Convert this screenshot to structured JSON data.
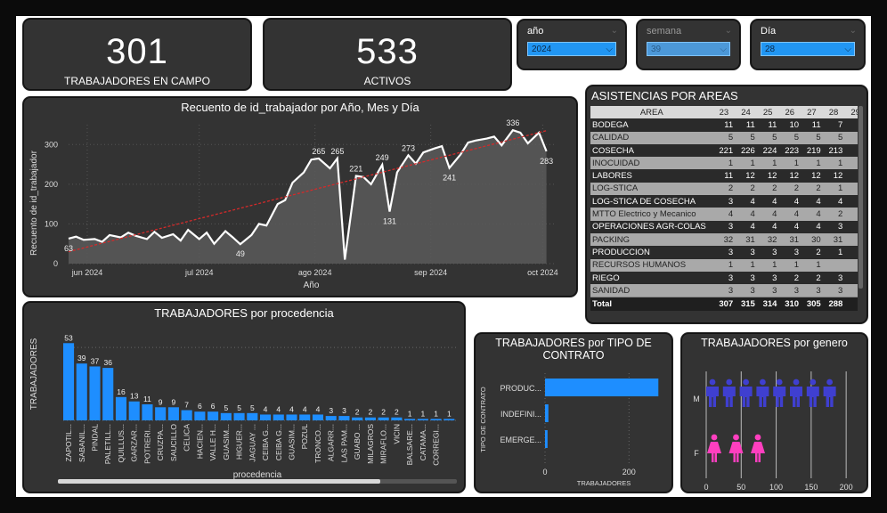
{
  "kpis": [
    {
      "value": "301",
      "label": "TRABAJADORES EN CAMPO"
    },
    {
      "value": "533",
      "label": "ACTIVOS"
    }
  ],
  "slicers": {
    "year": {
      "label": "año",
      "value": "2024"
    },
    "week": {
      "label": "semana",
      "value": "39"
    },
    "day": {
      "label": "Día",
      "value": "28"
    }
  },
  "line_chart": {
    "title": "Recuento de id_trabajador por Año, Mes y Día",
    "xlabel": "Año",
    "ylabel": "Recuento de id_trabajador",
    "y_ticks": [
      "0",
      "100",
      "200",
      "300"
    ],
    "x_ticks": [
      "jun 2024",
      "jul 2024",
      "ago 2024",
      "sep 2024",
      "oct 2024"
    ],
    "annotations": [
      "63",
      "49",
      "265",
      "265",
      "221",
      "249",
      "131",
      "273",
      "241",
      "336",
      "283"
    ]
  },
  "attendance": {
    "title": "ASISTENCIAS POR AREAS",
    "columns": [
      "AREA",
      "23",
      "24",
      "25",
      "26",
      "27",
      "28",
      "29"
    ],
    "rows": [
      [
        "BODEGA",
        "11",
        "11",
        "11",
        "10",
        "11",
        "7",
        ""
      ],
      [
        "CALIDAD",
        "5",
        "5",
        "5",
        "5",
        "5",
        "5",
        ""
      ],
      [
        "COSECHA",
        "221",
        "226",
        "224",
        "223",
        "219",
        "213",
        ""
      ],
      [
        "INOCUIDAD",
        "1",
        "1",
        "1",
        "1",
        "1",
        "1",
        ""
      ],
      [
        "LABORES",
        "11",
        "12",
        "12",
        "12",
        "12",
        "12",
        ""
      ],
      [
        "LOG-STICA",
        "2",
        "2",
        "2",
        "2",
        "2",
        "1",
        "1"
      ],
      [
        "LOG-STICA DE COSECHA",
        "3",
        "4",
        "4",
        "4",
        "4",
        "4",
        ""
      ],
      [
        "MTTO Electrico y Mecanico",
        "4",
        "4",
        "4",
        "4",
        "4",
        "2",
        ""
      ],
      [
        "OPERACIONES AGR-COLAS",
        "3",
        "4",
        "4",
        "4",
        "4",
        "3",
        ""
      ],
      [
        "PACKING",
        "32",
        "31",
        "32",
        "31",
        "30",
        "31",
        ""
      ],
      [
        "PRODUCCION",
        "3",
        "3",
        "3",
        "3",
        "2",
        "1",
        "1"
      ],
      [
        "RECURSOS HUMANOS",
        "1",
        "1",
        "1",
        "1",
        "1",
        "",
        ""
      ],
      [
        "RIEGO",
        "3",
        "3",
        "3",
        "2",
        "2",
        "3",
        ""
      ],
      [
        "SANIDAD",
        "3",
        "3",
        "3",
        "3",
        "3",
        "3",
        ""
      ]
    ],
    "total": [
      "Total",
      "307",
      "315",
      "314",
      "310",
      "305",
      "288",
      "2"
    ]
  },
  "procedencia": {
    "title": "TRABAJADORES por procedencia",
    "xlabel": "procedencia",
    "ylabel": "TRABAJADORES"
  },
  "contrato": {
    "title_line1": "TRABAJADORES por TIPO DE",
    "title_line2": "CONTRATO",
    "ylabel": "TIPO DE CONTRATO",
    "xlabel": "TRABAJADORES",
    "x_ticks": [
      "0",
      "200"
    ]
  },
  "genero": {
    "title": "TRABAJADORES por genero",
    "categories": [
      "M",
      "F"
    ],
    "x_ticks": [
      "0",
      "50",
      "100",
      "150",
      "200"
    ],
    "male_icons": 8,
    "female_icons": 3,
    "male_color": "#3f3fd0",
    "female_color": "#ff3fbf"
  },
  "chart_data": [
    {
      "type": "line",
      "title": "Recuento de id_trabajador por Año, Mes y Día",
      "xlabel": "Año",
      "ylabel": "Recuento de id_trabajador",
      "ylim": [
        0,
        350
      ],
      "x": [
        "2024-05-27",
        "2024-05-29",
        "2024-05-31",
        "2024-06-03",
        "2024-06-05",
        "2024-06-07",
        "2024-06-10",
        "2024-06-12",
        "2024-06-14",
        "2024-06-17",
        "2024-06-19",
        "2024-06-21",
        "2024-06-24",
        "2024-06-26",
        "2024-06-28",
        "2024-07-01",
        "2024-07-03",
        "2024-07-05",
        "2024-07-08",
        "2024-07-10",
        "2024-07-12",
        "2024-07-15",
        "2024-07-17",
        "2024-07-19",
        "2024-07-22",
        "2024-07-24",
        "2024-07-26",
        "2024-07-29",
        "2024-07-31",
        "2024-08-02",
        "2024-08-05",
        "2024-08-07",
        "2024-08-09",
        "2024-08-12",
        "2024-08-14",
        "2024-08-16",
        "2024-08-19",
        "2024-08-21",
        "2024-08-23",
        "2024-08-26",
        "2024-08-28",
        "2024-08-30",
        "2024-09-02",
        "2024-09-04",
        "2024-09-06",
        "2024-09-09",
        "2024-09-11",
        "2024-09-13",
        "2024-09-16",
        "2024-09-18",
        "2024-09-20",
        "2024-09-23",
        "2024-09-25",
        "2024-09-27",
        "2024-09-30",
        "2024-10-02"
      ],
      "values": [
        63,
        68,
        60,
        62,
        55,
        72,
        66,
        78,
        70,
        62,
        80,
        65,
        74,
        58,
        85,
        62,
        78,
        50,
        82,
        66,
        49,
        72,
        100,
        96,
        150,
        160,
        204,
        230,
        262,
        265,
        240,
        265,
        10,
        221,
        218,
        200,
        249,
        131,
        230,
        273,
        252,
        280,
        290,
        296,
        241,
        275,
        305,
        310,
        315,
        320,
        298,
        336,
        330,
        303,
        330,
        283
      ],
      "trend": [
        30,
        335
      ],
      "annotations": [
        {
          "x": "2024-05-27",
          "label": "63"
        },
        {
          "x": "2024-07-12",
          "label": "49"
        },
        {
          "x": "2024-08-02",
          "label": "265"
        },
        {
          "x": "2024-08-07",
          "label": "265"
        },
        {
          "x": "2024-08-12",
          "label": "221"
        },
        {
          "x": "2024-08-19",
          "label": "249"
        },
        {
          "x": "2024-08-21",
          "label": "131"
        },
        {
          "x": "2024-08-26",
          "label": "273"
        },
        {
          "x": "2024-09-06",
          "label": "241"
        },
        {
          "x": "2024-09-23",
          "label": "336"
        },
        {
          "x": "2024-10-02",
          "label": "283"
        }
      ]
    },
    {
      "type": "bar",
      "title": "TRABAJADORES por procedencia",
      "xlabel": "procedencia",
      "ylabel": "TRABAJADORES",
      "categories": [
        "ZAPOTIL...",
        "SABANIL...",
        "PINDAL",
        "PALETILL...",
        "QUILLUS...",
        "GARZAR...",
        "POTRERI...",
        "CRUZPA...",
        "SAUCILLO",
        "CELICA",
        "HACIEN...",
        "VALLE H...",
        "GUASIM...",
        "HIGUER...",
        "JAGUAY ...",
        "CEIBA G...",
        "CEIBA G...",
        "GUASIM...",
        "POZUL",
        "TRONCO...",
        "ALGARR...",
        "LAS PAM...",
        "GUABO ...",
        "MILAGROS",
        "MIRAFLO...",
        "VICIN",
        "BALSARE...",
        "CATAMA...",
        "CORREGI...",
        ""
      ],
      "values": [
        53,
        39,
        37,
        36,
        16,
        13,
        11,
        9,
        9,
        7,
        6,
        6,
        5,
        5,
        5,
        4,
        4,
        4,
        4,
        4,
        3,
        3,
        2,
        2,
        2,
        2,
        1,
        1,
        1,
        1
      ]
    },
    {
      "type": "bar",
      "title": "TRABAJADORES por TIPO DE CONTRATO",
      "xlabel": "TRABAJADORES",
      "ylabel": "TIPO DE CONTRATO",
      "orientation": "horizontal",
      "categories": [
        "PRODUC...",
        "INDEFINI...",
        "EMERGE..."
      ],
      "values": [
        270,
        8,
        6
      ],
      "xlim": [
        0,
        280
      ]
    },
    {
      "type": "bar",
      "title": "TRABAJADORES por genero",
      "orientation": "horizontal",
      "categories": [
        "M",
        "F"
      ],
      "values": [
        200,
        95
      ],
      "xlim": [
        0,
        210
      ]
    }
  ]
}
